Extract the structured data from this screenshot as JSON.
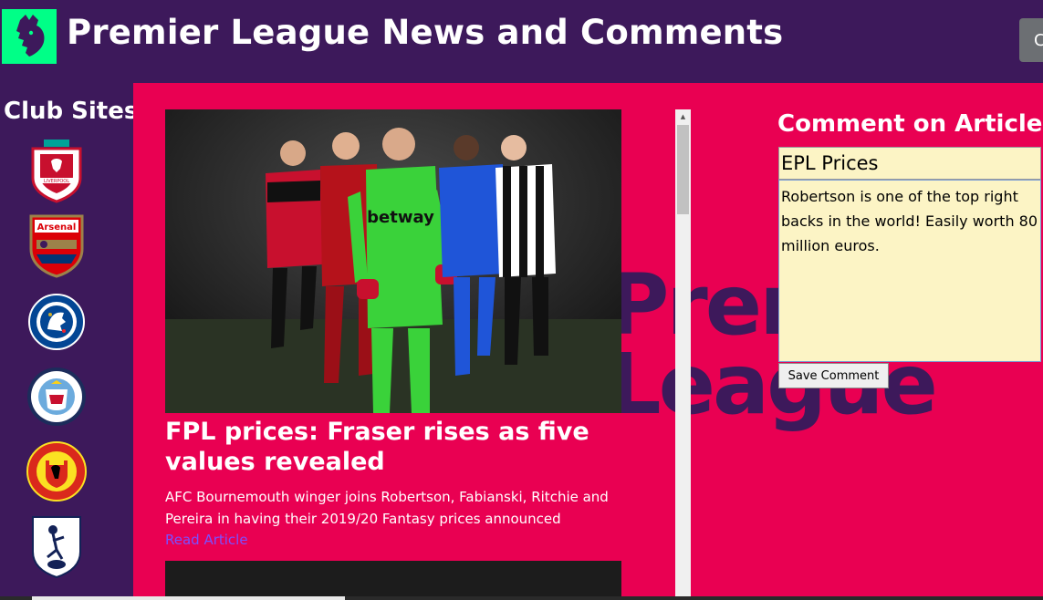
{
  "header": {
    "title": "Premier League News and Comments",
    "logo_icon": "premier-league-lion-icon",
    "right_button_label": "C"
  },
  "sidebar": {
    "title": "Club Sites",
    "clubs": [
      {
        "name": "LIVERPOOL",
        "icon": "liverpool-crest-icon"
      },
      {
        "name": "Arsenal",
        "icon": "arsenal-crest-icon"
      },
      {
        "name": "CHELSEA",
        "icon": "chelsea-crest-icon"
      },
      {
        "name": "MANCHESTER CITY",
        "icon": "manchester-city-crest-icon"
      },
      {
        "name": "MANCHESTER UNITED",
        "icon": "manchester-united-crest-icon"
      },
      {
        "name": "Tottenham",
        "icon": "tottenham-crest-icon"
      }
    ]
  },
  "article": {
    "title": "FPL prices: Fraser rises as five values revealed",
    "summary": "AFC Bournemouth winger joins Robertson, Fabianski, Ritchie and Pereira in having their 2019/20 Fantasy prices announced",
    "link_label": "Read Article"
  },
  "watermark": {
    "line1": "Premier",
    "line2": "League"
  },
  "comment": {
    "heading": "Comment on Article",
    "title_value": "EPL Prices",
    "body_value": "Robertson is one of the top right backs in the world! Easily worth 80 million euros.",
    "save_label": "Save Comment"
  },
  "colors": {
    "brand_purple": "#3d195b",
    "brand_pink": "#e90052",
    "brand_green": "#00ff87",
    "input_bg": "#fcf4c5",
    "link": "#7b4fff"
  }
}
